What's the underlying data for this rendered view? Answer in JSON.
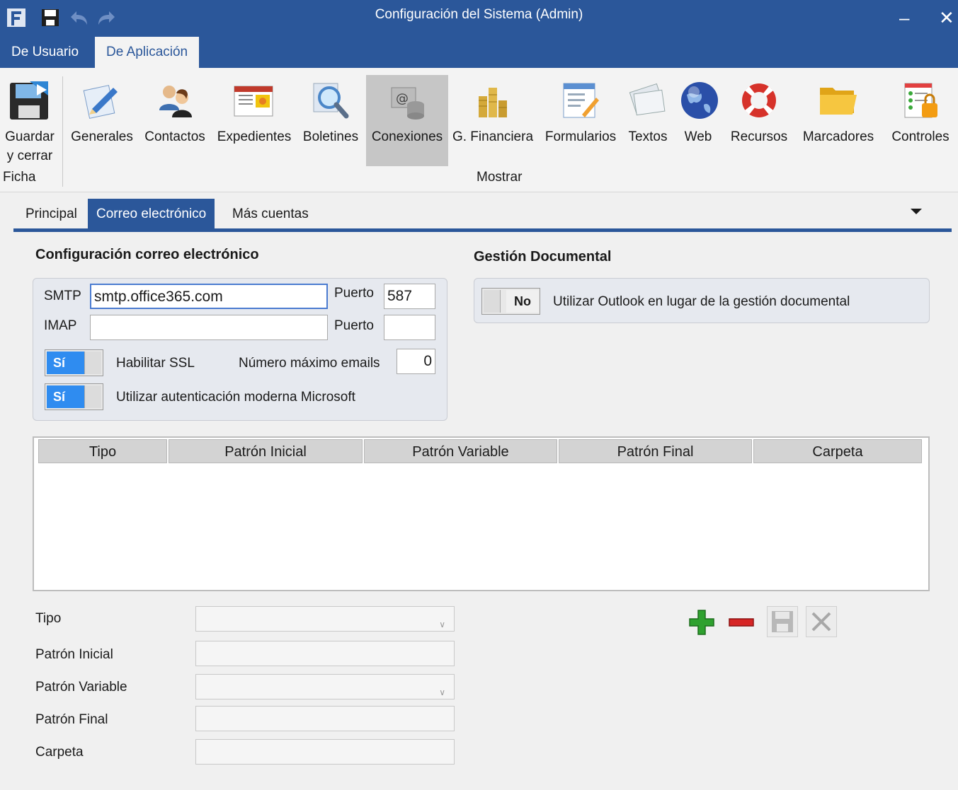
{
  "window": {
    "title": "Configuración del Sistema (Admin)",
    "minimize": "–",
    "close": "✕"
  },
  "ribbon_tabs": [
    "De Usuario",
    "De Aplicación"
  ],
  "ribbon": {
    "ficha_group": "Ficha",
    "mostrar_group": "Mostrar",
    "save_close_line1": "Guardar",
    "save_close_line2": "y cerrar",
    "buttons": [
      "Generales",
      "Contactos",
      "Expedientes",
      "Boletines",
      "Conexiones",
      "G. Financiera",
      "Formularios",
      "Textos",
      "Web",
      "Recursos",
      "Marcadores",
      "Controles"
    ]
  },
  "page_tabs": [
    "Principal",
    "Correo electrónico",
    "Más cuentas"
  ],
  "email": {
    "section_title": "Configuración correo electrónico",
    "smtp_label": "SMTP",
    "smtp_value": "smtp.office365.com",
    "smtp_port_label": "Puerto",
    "smtp_port_value": "587",
    "imap_label": "IMAP",
    "imap_value": "",
    "imap_port_label": "Puerto",
    "imap_port_value": "",
    "ssl_toggle": "Sí",
    "ssl_label": "Habilitar SSL",
    "max_emails_label": "Número máximo emails",
    "max_emails_value": "0",
    "modern_auth_toggle": "Sí",
    "modern_auth_label": "Utilizar autenticación moderna Microsoft"
  },
  "docs": {
    "section_title": "Gestión Documental",
    "toggle": "No",
    "label": "Utilizar Outlook en lugar de la gestión documental"
  },
  "grid": {
    "columns": [
      "Tipo",
      "Patrón Inicial",
      "Patrón Variable",
      "Patrón Final",
      "Carpeta"
    ],
    "rows": []
  },
  "form": {
    "tipo_label": "Tipo",
    "patron_inicial_label": "Patrón Inicial",
    "patron_variable_label": "Patrón Variable",
    "patron_final_label": "Patrón Final",
    "carpeta_label": "Carpeta"
  }
}
